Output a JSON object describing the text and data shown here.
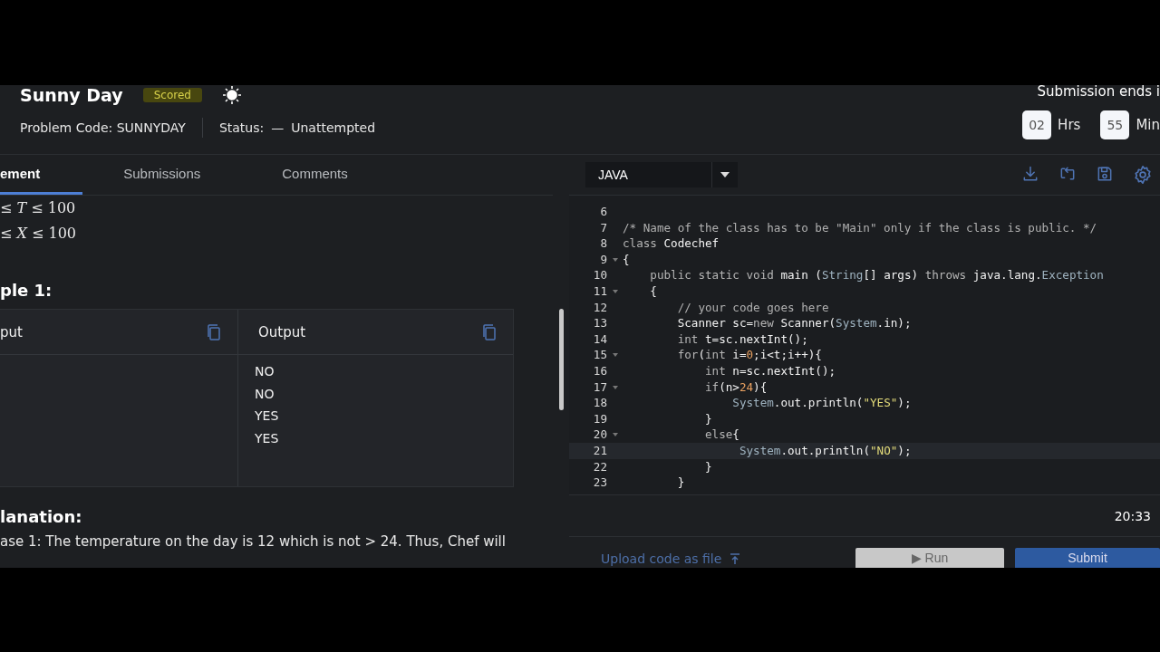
{
  "problem": {
    "title": "Sunny Day",
    "badge": "Scored",
    "code_label": "Problem Code: SUNNYDAY",
    "status_label": "Status:",
    "status_dash": "—",
    "status": "Unattempted"
  },
  "timer": {
    "caption": "Submission ends i",
    "units": [
      {
        "value": "02",
        "label": "Hrs"
      },
      {
        "value": "55",
        "label": "Min"
      }
    ]
  },
  "tabs": [
    {
      "label": "ement",
      "selected": true
    },
    {
      "label": "Submissions",
      "selected": false
    },
    {
      "label": "Comments",
      "selected": false
    }
  ],
  "constraints": [
    "≤ *T* ≤ 100",
    "≤ *X* ≤ 100"
  ],
  "example": {
    "heading": "ple 1:",
    "input_header": "put",
    "output_header": "Output",
    "output_lines": [
      "NO",
      "NO",
      "YES",
      "YES"
    ]
  },
  "explanation": {
    "heading": "lanation:",
    "text": "ase 1: The temperature on the day is 12 which is not > 24. Thus, Chef will"
  },
  "editor": {
    "language": "JAVA",
    "lines": [
      {
        "number": "6",
        "foldable": false,
        "highlighted": false
      },
      {
        "number": "7",
        "foldable": false,
        "highlighted": false,
        "segments": [
          {
            "text": "/* Name of the class has to be \"Main\" only if the class is public. */",
            "kind": "comment"
          }
        ]
      },
      {
        "number": "8",
        "foldable": false,
        "highlighted": false,
        "segments": [
          {
            "text": "class ",
            "kind": "keyword"
          },
          {
            "text": "Codechef",
            "kind": "plain"
          }
        ]
      },
      {
        "number": "9",
        "foldable": true,
        "highlighted": false,
        "segments": [
          {
            "text": "{",
            "kind": "plain"
          }
        ]
      },
      {
        "number": "10",
        "foldable": false,
        "highlighted": false,
        "segments": [
          {
            "text": "    public static void ",
            "kind": "keyword"
          },
          {
            "text": "main (",
            "kind": "plain"
          },
          {
            "text": "String",
            "kind": "type"
          },
          {
            "text": "[] args) ",
            "kind": "plain"
          },
          {
            "text": "throws ",
            "kind": "keyword"
          },
          {
            "text": "java.lang.",
            "kind": "plain"
          },
          {
            "text": "Exception",
            "kind": "type"
          }
        ]
      },
      {
        "number": "11",
        "foldable": true,
        "highlighted": false,
        "segments": [
          {
            "text": "    {",
            "kind": "plain"
          }
        ]
      },
      {
        "number": "12",
        "foldable": false,
        "highlighted": false,
        "segments": [
          {
            "text": "        // your code goes here",
            "kind": "comment"
          }
        ]
      },
      {
        "number": "13",
        "foldable": false,
        "highlighted": false,
        "segments": [
          {
            "text": "        Scanner sc=",
            "kind": "plain"
          },
          {
            "text": "new ",
            "kind": "keyword"
          },
          {
            "text": "Scanner(",
            "kind": "plain"
          },
          {
            "text": "System",
            "kind": "type"
          },
          {
            "text": ".in);",
            "kind": "plain"
          }
        ]
      },
      {
        "number": "14",
        "foldable": false,
        "highlighted": false,
        "segments": [
          {
            "text": "        int ",
            "kind": "keyword"
          },
          {
            "text": "t=sc.nextInt();",
            "kind": "plain"
          }
        ]
      },
      {
        "number": "15",
        "foldable": true,
        "highlighted": false,
        "segments": [
          {
            "text": "        for",
            "kind": "keyword"
          },
          {
            "text": "(",
            "kind": "plain"
          },
          {
            "text": "int ",
            "kind": "keyword"
          },
          {
            "text": "i=",
            "kind": "plain"
          },
          {
            "text": "0",
            "kind": "number"
          },
          {
            "text": ";i<t;i++){",
            "kind": "plain"
          }
        ]
      },
      {
        "number": "16",
        "foldable": false,
        "highlighted": false,
        "segments": [
          {
            "text": "            int ",
            "kind": "keyword"
          },
          {
            "text": "n=sc.nextInt();",
            "kind": "plain"
          }
        ]
      },
      {
        "number": "17",
        "foldable": true,
        "highlighted": false,
        "segments": [
          {
            "text": "            if",
            "kind": "keyword"
          },
          {
            "text": "(n>",
            "kind": "plain"
          },
          {
            "text": "24",
            "kind": "number"
          },
          {
            "text": "){",
            "kind": "plain"
          }
        ]
      },
      {
        "number": "18",
        "foldable": false,
        "highlighted": false,
        "segments": [
          {
            "text": "                System",
            "kind": "type"
          },
          {
            "text": ".out.println(",
            "kind": "plain"
          },
          {
            "text": "\"YES\"",
            "kind": "string"
          },
          {
            "text": ");",
            "kind": "plain"
          }
        ]
      },
      {
        "number": "19",
        "foldable": false,
        "highlighted": false,
        "segments": [
          {
            "text": "            }",
            "kind": "plain"
          }
        ]
      },
      {
        "number": "20",
        "foldable": true,
        "highlighted": false,
        "segments": [
          {
            "text": "            else",
            "kind": "keyword"
          },
          {
            "text": "{",
            "kind": "plain"
          }
        ]
      },
      {
        "number": "21",
        "foldable": false,
        "highlighted": true,
        "segments": [
          {
            "text": "                 System",
            "kind": "type"
          },
          {
            "text": ".out.println(",
            "kind": "plain"
          },
          {
            "text": "\"NO\"",
            "kind": "string"
          },
          {
            "text": ");",
            "kind": "plain"
          }
        ]
      },
      {
        "number": "22",
        "foldable": false,
        "highlighted": false,
        "segments": [
          {
            "text": "            }",
            "kind": "plain"
          }
        ]
      },
      {
        "number": "23",
        "foldable": false,
        "highlighted": false,
        "segments": [
          {
            "text": "        }",
            "kind": "plain"
          }
        ]
      }
    ],
    "time": "20:33",
    "upload_label": "Upload code as file",
    "run_label": "▶ Run",
    "submit_label": "Submit"
  }
}
